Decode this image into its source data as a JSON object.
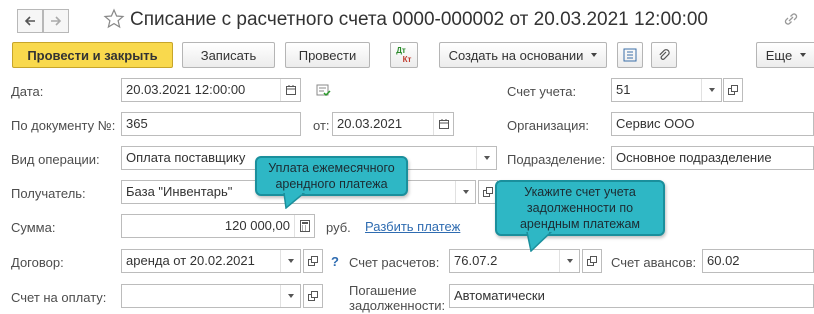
{
  "window": {
    "title": "Списание с расчетного счета 0000-000002 от 20.03.2021 12:00:00"
  },
  "toolbar": {
    "post_and_close": "Провести и закрыть",
    "save": "Записать",
    "post": "Провести",
    "dt_kt_top": "Дт",
    "dt_kt_bottom": "Кт",
    "create_based_on": "Создать на основании",
    "more": "Еще"
  },
  "form": {
    "date_label": "Дата:",
    "date_value": "20.03.2021 12:00:00",
    "doc_number_label": "По документу №:",
    "doc_number_value": "365",
    "doc_date_label": "от:",
    "doc_date_value": "20.03.2021",
    "operation_label": "Вид операции:",
    "operation_value": "Оплата поставщику",
    "recipient_label": "Получатель:",
    "recipient_value": "База \"Инвентарь\"",
    "amount_label": "Сумма:",
    "amount_value": "120 000,00",
    "currency": "руб.",
    "split_payment": "Разбить платеж",
    "contract_label": "Договор:",
    "contract_value": "аренда от 20.02.2021",
    "contract_help": "?",
    "invoice_label": "Счет на оплату:",
    "invoice_value": "",
    "account_label": "Счет учета:",
    "account_value": "51",
    "org_label": "Организация:",
    "org_value": "Сервис ООО",
    "dept_label": "Подразделение:",
    "dept_value": "Основное подразделение",
    "settlement_account_label": "Счет расчетов:",
    "settlement_account_value": "76.07.2",
    "advance_account_label": "Счет авансов:",
    "advance_account_value": "60.02",
    "debt_repayment_label_1": "Погашение",
    "debt_repayment_label_2": "задолженности:",
    "debt_repayment_value": "Автоматически"
  },
  "callouts": {
    "monthly_rent_1": "Уплата ежемесячного",
    "monthly_rent_2": "арендного платежа",
    "debt_account_1": "Укажите счет учета",
    "debt_account_2": "задолженности по",
    "debt_account_3": "арендным платежам"
  },
  "colors": {
    "primary_button": "#f9d94d",
    "callout": "#2eb7c5",
    "link": "#2f6cb1"
  }
}
